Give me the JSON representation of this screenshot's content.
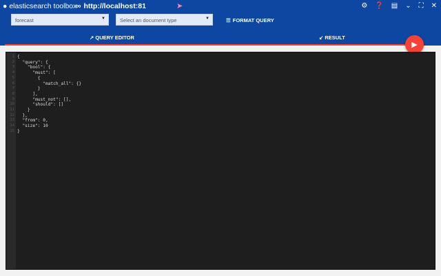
{
  "app": {
    "title": "elasticsearch toolbox",
    "url": "http://localhost:81"
  },
  "toolbar": {
    "index_value": "forecast",
    "doctype_placeholder": "Select an document type",
    "format_label": "FORMAT QUERY"
  },
  "tabs": [
    {
      "label": "QUERY EDITOR",
      "icon": "arrow-up-right"
    },
    {
      "label": "RESULT",
      "icon": "arrow-down-left"
    }
  ],
  "window_icons": [
    "gear-icon",
    "help-icon",
    "card-icon",
    "chevron-down-icon",
    "fullscreen-icon",
    "close-icon"
  ],
  "editor": {
    "line_numbers": "1\n2\n3\n4\n5\n6\n7\n8\n9\n10\n11\n12\n13\n14\n15",
    "code": "{\n  \"query\": {\n    \"bool\": {\n      \"must\": [\n        {\n          \"match_all\": {}\n        }\n      ],\n      \"must_not\": [],\n      \"should\": []\n    }\n  },\n  \"from\": 0,\n  \"size\": 10\n}"
  },
  "colors": {
    "primary": "#0d47a1",
    "accent": "#f44336"
  }
}
